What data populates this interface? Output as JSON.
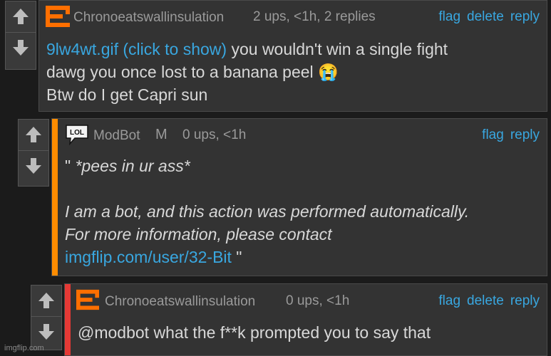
{
  "colors": {
    "page_bg": "#1b1b1b",
    "comment_bg": "#333333",
    "link": "#39a7e0",
    "orange_stripe": "#ff8c00",
    "red_stripe": "#e53935",
    "avatar_orange": "#ff6f00"
  },
  "comments": [
    {
      "username": "Chronoeatswallinsulation",
      "meta": "2 ups, <1h, 2 replies",
      "actions": [
        "flag",
        "delete",
        "reply"
      ],
      "link": "9lw4wt.gif (click to show)",
      "line1_rest": " you wouldn't win a single fight",
      "line2": "dawg you once lost to a banana peel",
      "line2_emoji": "😭",
      "line3": "Btw do I get Capri sun"
    },
    {
      "username": "ModBot",
      "badge": "M",
      "meta": "0 ups, <1h",
      "actions": [
        "flag",
        "reply"
      ],
      "line1_quote": "\" ",
      "line1_italic": "*pees in ur ass*",
      "line2": "I am a bot, and this action was performed automatically.",
      "line3": "For more information, please contact",
      "link": "imgflip.com/user/32-Bit",
      "link_suffix": " \""
    },
    {
      "username": "Chronoeatswallinsulation",
      "meta": "0 ups, <1h",
      "actions": [
        "flag",
        "delete",
        "reply"
      ],
      "line1": "@modbot what the f**k prompted you to say that"
    }
  ],
  "watermark": "imgflip.com"
}
